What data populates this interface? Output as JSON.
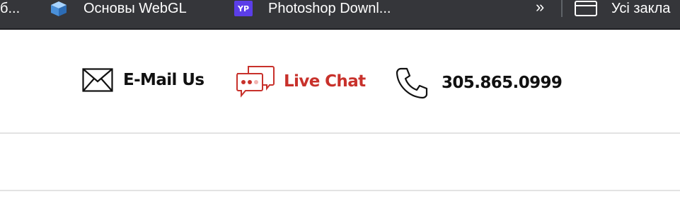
{
  "bookmarks_bar": {
    "items": [
      {
        "label": "б...",
        "icon": "truncated-item"
      },
      {
        "label": "Основы WebGL",
        "icon": "cube-icon"
      },
      {
        "label": "Photoshop Downl...",
        "icon": "yp-icon"
      }
    ],
    "overflow_label": "»",
    "all_bookmarks": {
      "label": "Усі закла",
      "icon": "folder-icon"
    }
  },
  "contact": {
    "email": {
      "label": "E-Mail Us",
      "icon": "envelope-icon"
    },
    "chat": {
      "label": "Live Chat",
      "icon": "chat-bubbles-icon",
      "color": "#c8312b"
    },
    "phone": {
      "label": "305.865.0999",
      "icon": "phone-icon"
    }
  },
  "colors": {
    "bookmarks_bg": "#35363a",
    "text": "#111111",
    "accent": "#c8312b",
    "rule": "#e3e3e3"
  }
}
